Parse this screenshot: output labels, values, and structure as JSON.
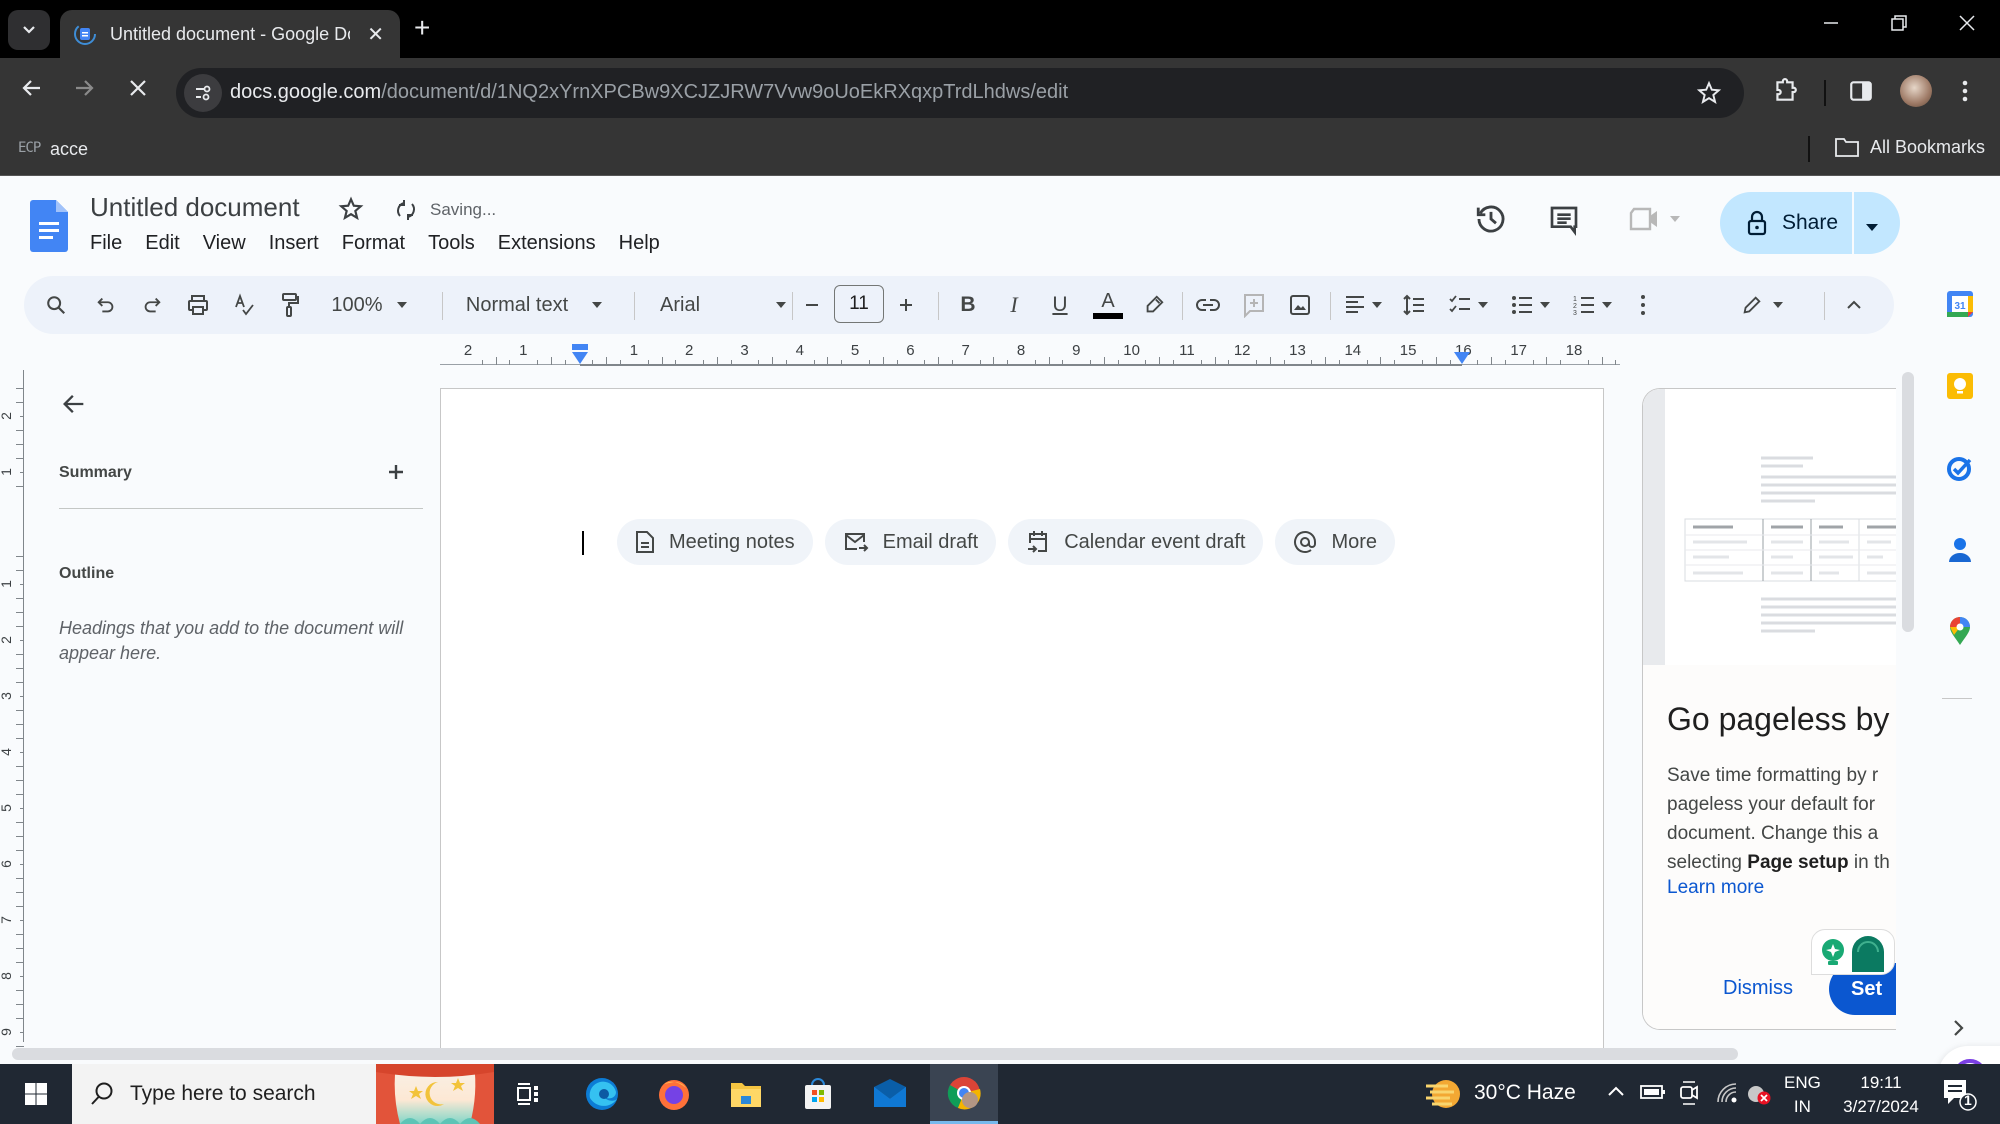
{
  "browser": {
    "tab_title": "Untitled document - Google Docs",
    "url_host": "docs.google.com",
    "url_path": "/document/d/1NQ2xYrnXPCBw9XCJZJRW7Vvw9oUoEkRXqxpTrdLhdws/edit",
    "bookmarks": [
      {
        "icon": "ECP",
        "label": "acce"
      }
    ],
    "all_bookmarks_label": "All Bookmarks"
  },
  "docs": {
    "title": "Untitled document",
    "save_status": "Saving...",
    "menu": [
      "File",
      "Edit",
      "View",
      "Insert",
      "Format",
      "Tools",
      "Extensions",
      "Help"
    ],
    "share_label": "Share",
    "toolbar": {
      "zoom": "100%",
      "style": "Normal text",
      "font": "Arial",
      "font_size": "11"
    },
    "ruler_numbers": [
      "2",
      "1",
      "",
      "1",
      "2",
      "3",
      "4",
      "5",
      "6",
      "7",
      "8",
      "9",
      "10",
      "11",
      "12",
      "13",
      "14",
      "15",
      "16",
      "17",
      "18"
    ],
    "vruler_numbers": [
      "2",
      "1",
      "1",
      "2",
      "3",
      "4",
      "5",
      "6",
      "7",
      "8",
      "9"
    ],
    "outline": {
      "summary_label": "Summary",
      "outline_label": "Outline",
      "empty_text": "Headings that you add to the document will appear here."
    },
    "chips": [
      {
        "icon": "document-icon",
        "label": "Meeting notes"
      },
      {
        "icon": "email-icon",
        "label": "Email draft"
      },
      {
        "icon": "calendar-icon",
        "label": "Calendar event draft"
      },
      {
        "icon": "at-icon",
        "label": "More"
      }
    ],
    "promo": {
      "title": "Go pageless by",
      "line1": "Save time formatting by r",
      "line2": "pageless your default for",
      "line3": "document. Change this a",
      "line4_pre": "selecting ",
      "line4_bold": "Page setup",
      "line4_post": " in th",
      "learn_more": "Learn more",
      "dismiss": "Dismiss",
      "set": "Set"
    }
  },
  "taskbar": {
    "search_placeholder": "Type here to search",
    "weather": "30°C  Haze",
    "lang_top": "ENG",
    "lang_bottom": "IN",
    "time": "19:11",
    "date": "3/27/2024",
    "notification_count": "1"
  },
  "colors": {
    "docs_blue": "#4285f4",
    "share_bg": "#c2e7ff",
    "link": "#0b57d0",
    "toolbar_bg": "#edf2fa"
  }
}
